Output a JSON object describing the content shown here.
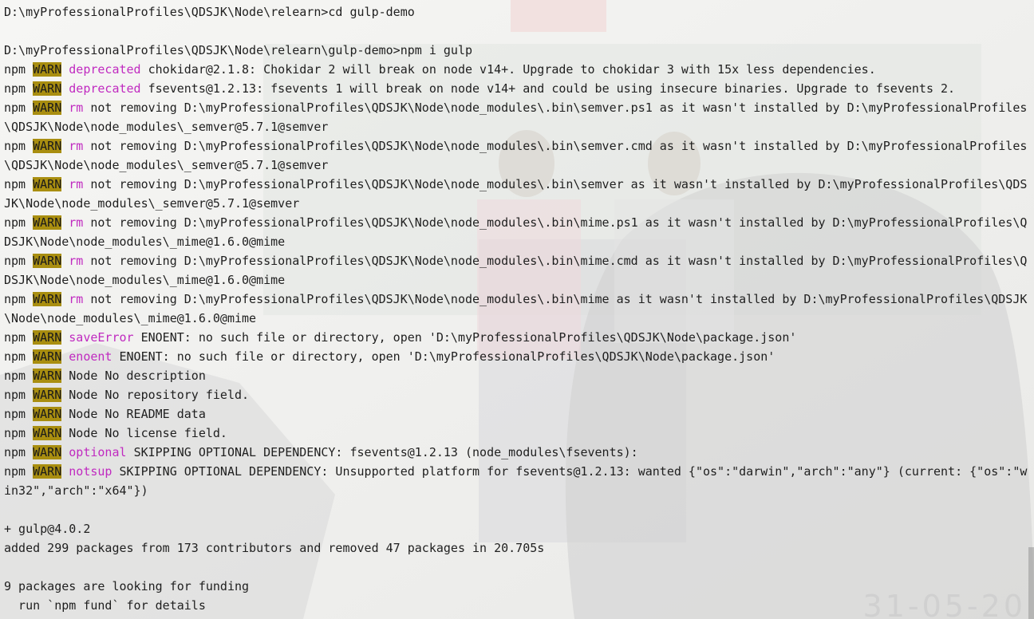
{
  "terminal": {
    "lines": [
      {
        "type": "text",
        "text": "D:\\myProfessionalProfiles\\QDSJK\\Node\\relearn>cd gulp-demo"
      },
      {
        "type": "text",
        "text": ""
      },
      {
        "type": "text",
        "text": "D:\\myProfessionalProfiles\\QDSJK\\Node\\relearn\\gulp-demo>npm i gulp"
      },
      {
        "type": "warn",
        "prefix": "npm",
        "badge": "WARN",
        "tag": "deprecated",
        "text": "chokidar@2.1.8: Chokidar 2 will break on node v14+. Upgrade to chokidar 3 with 15x less dependencies."
      },
      {
        "type": "warn",
        "prefix": "npm",
        "badge": "WARN",
        "tag": "deprecated",
        "text": "fsevents@1.2.13: fsevents 1 will break on node v14+ and could be using insecure binaries. Upgrade to fsevents 2."
      },
      {
        "type": "warn",
        "prefix": "npm",
        "badge": "WARN",
        "tag": "rm",
        "text": "not removing D:\\myProfessionalProfiles\\QDSJK\\Node\\node_modules\\.bin\\semver.ps1 as it wasn't installed by D:\\myProfessionalProfiles"
      },
      {
        "type": "text",
        "text": "\\QDSJK\\Node\\node_modules\\_semver@5.7.1@semver"
      },
      {
        "type": "warn",
        "prefix": "npm",
        "badge": "WARN",
        "tag": "rm",
        "text": "not removing D:\\myProfessionalProfiles\\QDSJK\\Node\\node_modules\\.bin\\semver.cmd as it wasn't installed by D:\\myProfessionalProfiles"
      },
      {
        "type": "text",
        "text": "\\QDSJK\\Node\\node_modules\\_semver@5.7.1@semver"
      },
      {
        "type": "warn",
        "prefix": "npm",
        "badge": "WARN",
        "tag": "rm",
        "text": "not removing D:\\myProfessionalProfiles\\QDSJK\\Node\\node_modules\\.bin\\semver as it wasn't installed by D:\\myProfessionalProfiles\\QDS"
      },
      {
        "type": "text",
        "text": "JK\\Node\\node_modules\\_semver@5.7.1@semver"
      },
      {
        "type": "warn",
        "prefix": "npm",
        "badge": "WARN",
        "tag": "rm",
        "text": "not removing D:\\myProfessionalProfiles\\QDSJK\\Node\\node_modules\\.bin\\mime.ps1 as it wasn't installed by D:\\myProfessionalProfiles\\Q"
      },
      {
        "type": "text",
        "text": "DSJK\\Node\\node_modules\\_mime@1.6.0@mime"
      },
      {
        "type": "warn",
        "prefix": "npm",
        "badge": "WARN",
        "tag": "rm",
        "text": "not removing D:\\myProfessionalProfiles\\QDSJK\\Node\\node_modules\\.bin\\mime.cmd as it wasn't installed by D:\\myProfessionalProfiles\\Q"
      },
      {
        "type": "text",
        "text": "DSJK\\Node\\node_modules\\_mime@1.6.0@mime"
      },
      {
        "type": "warn",
        "prefix": "npm",
        "badge": "WARN",
        "tag": "rm",
        "text": "not removing D:\\myProfessionalProfiles\\QDSJK\\Node\\node_modules\\.bin\\mime as it wasn't installed by D:\\myProfessionalProfiles\\QDSJK"
      },
      {
        "type": "text",
        "text": "\\Node\\node_modules\\_mime@1.6.0@mime"
      },
      {
        "type": "warn",
        "prefix": "npm",
        "badge": "WARN",
        "tag": "saveError",
        "text": "ENOENT: no such file or directory, open 'D:\\myProfessionalProfiles\\QDSJK\\Node\\package.json'"
      },
      {
        "type": "warn",
        "prefix": "npm",
        "badge": "WARN",
        "tag": "enoent",
        "text": "ENOENT: no such file or directory, open 'D:\\myProfessionalProfiles\\QDSJK\\Node\\package.json'"
      },
      {
        "type": "warn",
        "prefix": "npm",
        "badge": "WARN",
        "tag": "",
        "text": "Node No description"
      },
      {
        "type": "warn",
        "prefix": "npm",
        "badge": "WARN",
        "tag": "",
        "text": "Node No repository field."
      },
      {
        "type": "warn",
        "prefix": "npm",
        "badge": "WARN",
        "tag": "",
        "text": "Node No README data"
      },
      {
        "type": "warn",
        "prefix": "npm",
        "badge": "WARN",
        "tag": "",
        "text": "Node No license field."
      },
      {
        "type": "warn",
        "prefix": "npm",
        "badge": "WARN",
        "tag": "optional",
        "text": "SKIPPING OPTIONAL DEPENDENCY: fsevents@1.2.13 (node_modules\\fsevents):"
      },
      {
        "type": "warn",
        "prefix": "npm",
        "badge": "WARN",
        "tag": "notsup",
        "text": "SKIPPING OPTIONAL DEPENDENCY: Unsupported platform for fsevents@1.2.13: wanted {\"os\":\"darwin\",\"arch\":\"any\"} (current: {\"os\":\"w"
      },
      {
        "type": "text",
        "text": "in32\",\"arch\":\"x64\"})"
      },
      {
        "type": "text",
        "text": ""
      },
      {
        "type": "text",
        "text": "+ gulp@4.0.2"
      },
      {
        "type": "text",
        "text": "added 299 packages from 173 contributors and removed 47 packages in 20.705s"
      },
      {
        "type": "text",
        "text": ""
      },
      {
        "type": "text",
        "text": "9 packages are looking for funding"
      },
      {
        "type": "text",
        "text": "  run `npm fund` for details"
      }
    ],
    "colors": {
      "text": "#1f1f1f",
      "warn_badge_bg": "#a98e10",
      "tag": "#c02ac0"
    }
  }
}
